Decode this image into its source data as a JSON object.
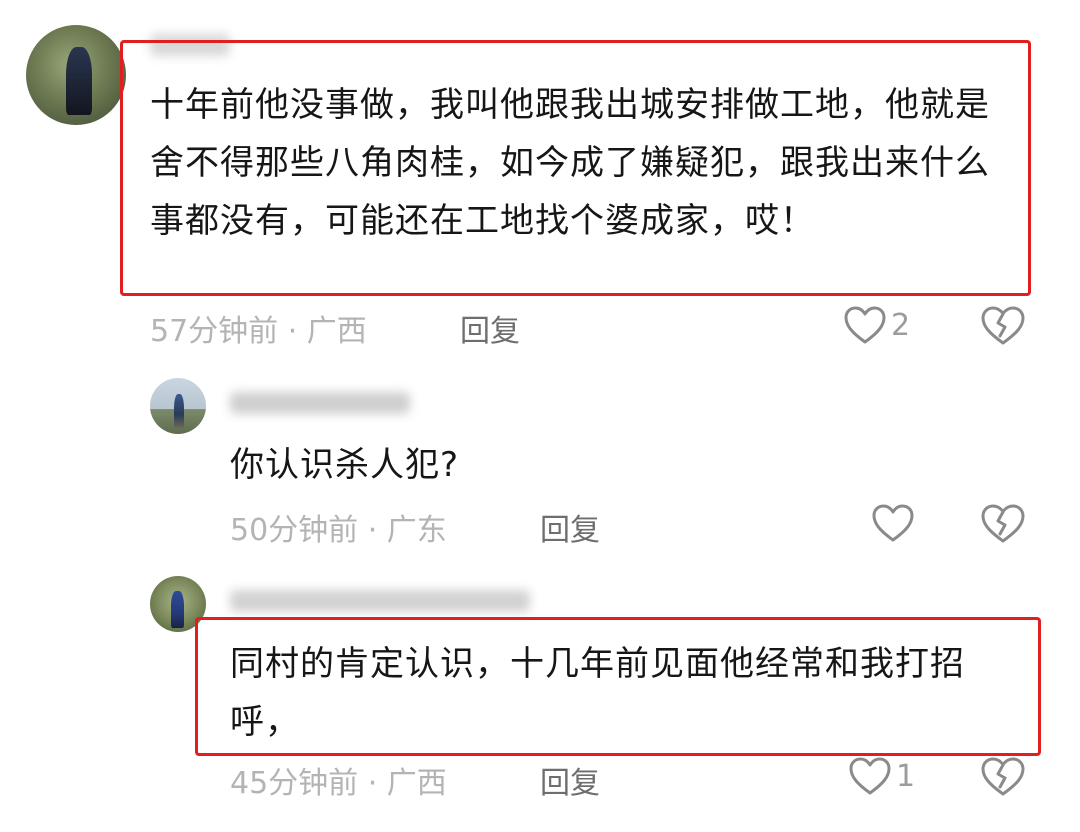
{
  "comments": [
    {
      "text": "十年前他没事做，我叫他跟我出城安排做工地，他就是舍不得那些八角肉桂，如今成了嫌疑犯，跟我出来什么事都没有，可能还在工地找个婆成家，哎！",
      "time": "57分钟前",
      "location": "广西",
      "reply_label": "回复",
      "likes": "2",
      "highlighted": true
    },
    {
      "text": "你认识杀人犯?",
      "time": "50分钟前",
      "location": "广东",
      "reply_label": "回复",
      "likes": "",
      "highlighted": false
    },
    {
      "text": "同村的肯定认识，十几年前见面他经常和我打招呼，",
      "time": "45分钟前",
      "location": "广西",
      "reply_label": "回复",
      "likes": "1",
      "highlighted": true
    }
  ],
  "meta_separator": " · ",
  "icons": {
    "like": "heart-outline-icon",
    "dislike": "broken-heart-icon"
  },
  "colors": {
    "highlight_border": "#e02020",
    "meta_text": "#b4b4b4",
    "icon_stroke": "#8a8a8a"
  }
}
